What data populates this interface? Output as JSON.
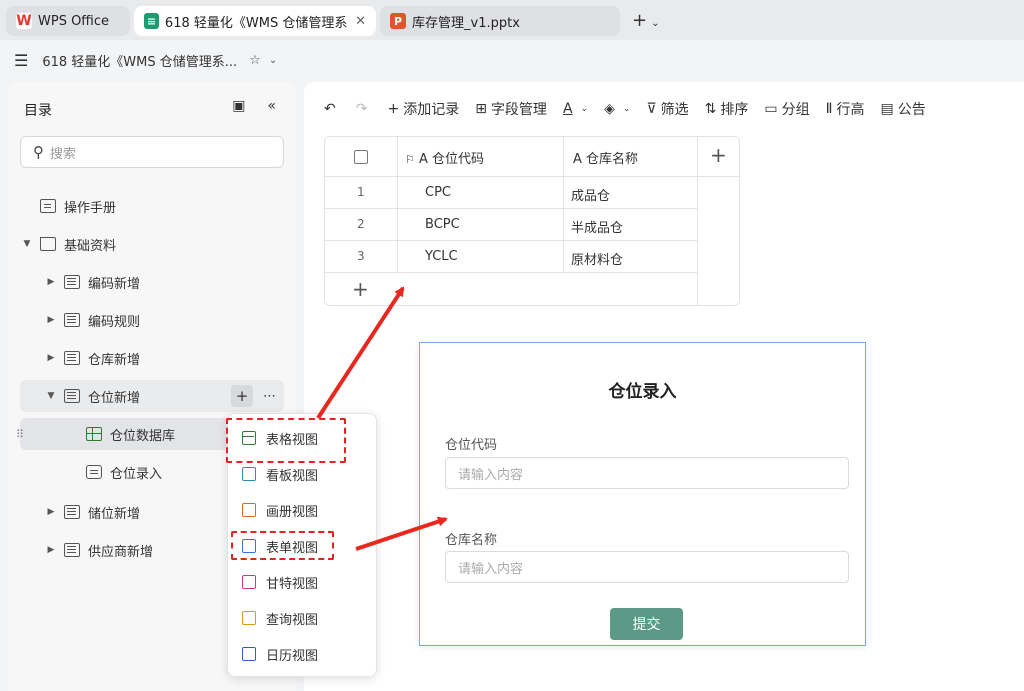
{
  "tabs": [
    {
      "label": "WPS Office",
      "logo": "W",
      "color": "#e8392f"
    },
    {
      "label": "618 轻量化《WMS 仓储管理系统",
      "logo": "≡",
      "color": "#1f9b72"
    },
    {
      "label": "库存管理_v1.pptx",
      "logo": "P",
      "color": "#e2542a"
    }
  ],
  "titlebar": {
    "title": "618 轻量化《WMS 仓储管理系..."
  },
  "sidebar": {
    "heading": "目录",
    "search_placeholder": "搜索",
    "items": [
      {
        "label": "操作手册"
      },
      {
        "label": "基础资料"
      },
      {
        "label": "编码新增"
      },
      {
        "label": "编码规则"
      },
      {
        "label": "仓库新增"
      },
      {
        "label": "仓位新增"
      },
      {
        "label": "仓位数据库"
      },
      {
        "label": "仓位录入"
      },
      {
        "label": "储位新增"
      },
      {
        "label": "供应商新增"
      }
    ]
  },
  "dropdown": {
    "items": [
      "表格视图",
      "看板视图",
      "画册视图",
      "表单视图",
      "甘特视图",
      "查询视图",
      "日历视图"
    ]
  },
  "toolbar": {
    "add_record": "添加记录",
    "field_manage": "字段管理",
    "filter": "筛选",
    "sort": "排序",
    "group": "分组",
    "row_height": "行高",
    "notice": "公告"
  },
  "table": {
    "columns": [
      "仓位代码",
      "仓库名称"
    ],
    "rows": [
      {
        "num": "1",
        "code": "CPC",
        "name": "成品仓"
      },
      {
        "num": "2",
        "code": "BCPC",
        "name": "半成品仓"
      },
      {
        "num": "3",
        "code": "YCLC",
        "name": "原材料仓"
      }
    ]
  },
  "form": {
    "title": "仓位录入",
    "field1_label": "仓位代码",
    "field1_placeholder": "请输入内容",
    "field2_label": "仓库名称",
    "field2_placeholder": "请输入内容",
    "submit": "提交"
  },
  "colors": {
    "accent_submit": "#5a9a86",
    "annotation_red": "#e02424",
    "form_border": "#7aa7e6"
  }
}
